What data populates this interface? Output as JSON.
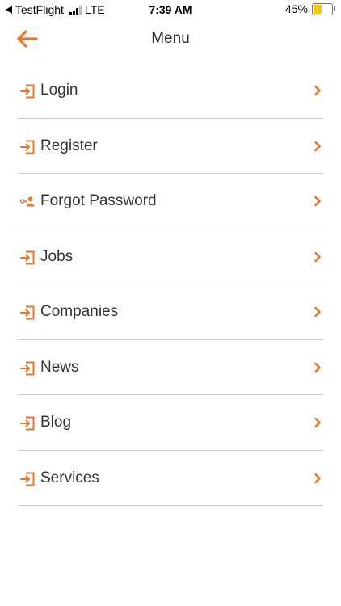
{
  "status_bar": {
    "carrier_back": "TestFlight",
    "network": "LTE",
    "time": "7:39 AM",
    "battery_percent": "45%",
    "battery_level": 0.45,
    "battery_color": "#f5c518"
  },
  "header": {
    "title": "Menu",
    "back_icon": "arrow-left-icon",
    "accent_color": "#e8762c"
  },
  "menu": {
    "items": [
      {
        "label": "Login",
        "icon": "sign-in-icon"
      },
      {
        "label": "Register",
        "icon": "sign-in-icon"
      },
      {
        "label": "Forgot Password",
        "icon": "user-key-icon"
      },
      {
        "label": "Jobs",
        "icon": "sign-in-icon"
      },
      {
        "label": "Companies",
        "icon": "sign-in-icon"
      },
      {
        "label": "News",
        "icon": "sign-in-icon"
      },
      {
        "label": "Blog",
        "icon": "sign-in-icon"
      },
      {
        "label": "Services",
        "icon": "sign-in-icon"
      }
    ]
  }
}
